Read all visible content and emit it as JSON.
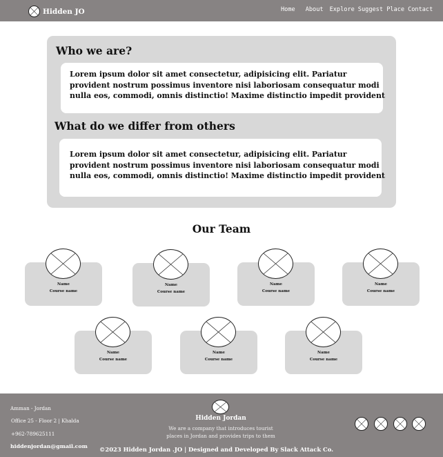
{
  "header": {
    "brand": "Hidden JO",
    "nav": [
      "Home",
      "About",
      "Explore",
      "Suggest Place",
      "Contact"
    ]
  },
  "about": {
    "sections": [
      {
        "title": "Who we are?",
        "text": "Lorem ipsum dolor sit amet consectetur, adipisicing elit. Pariatur provident nostrum possimus inventore nisi laboriosam consequatur modi nulla eos, commodi, omnis distinctio! Maxime distinctio impedit provident"
      },
      {
        "title": "What do we differ from others",
        "text": "Lorem ipsum dolor sit amet consectetur, adipisicing elit. Pariatur provident nostrum possimus inventore nisi laboriosam consequatur modi nulla eos, commodi, omnis distinctio! Maxime distinctio impedit provident"
      }
    ]
  },
  "team": {
    "title": "Our Team",
    "members": [
      {
        "name": "Name",
        "course": "Course name"
      },
      {
        "name": "Name",
        "course": "Course name"
      },
      {
        "name": "Name",
        "course": "Course name"
      },
      {
        "name": "Name",
        "course": "Course name"
      },
      {
        "name": "Name",
        "course": "Course name"
      },
      {
        "name": "Name",
        "course": "Course name"
      },
      {
        "name": "Name",
        "course": "Course name"
      }
    ]
  },
  "footer": {
    "location": "Amman - Jordan",
    "office": "Office 25 - Floor 2 | Khalda",
    "phone": "+962-789625111",
    "email": "hiddenjordan@gmail.com",
    "company": "Hidden Jordan",
    "description_line1": "We are a company that introduces tourist",
    "description_line2": "places in Jordan and provides trips to them",
    "copyright": "©2023 Hidden Jordan .JO | Designed and Developed By Slack Attack Co."
  },
  "icons": {
    "placeholder": "image-placeholder-icon",
    "social": [
      "social-icon-1",
      "social-icon-2",
      "social-icon-3",
      "social-icon-4"
    ]
  },
  "colors": {
    "header_footer_bg": "#878383",
    "panel_bg": "#d8d8d8",
    "card_bg": "#ffffff"
  }
}
